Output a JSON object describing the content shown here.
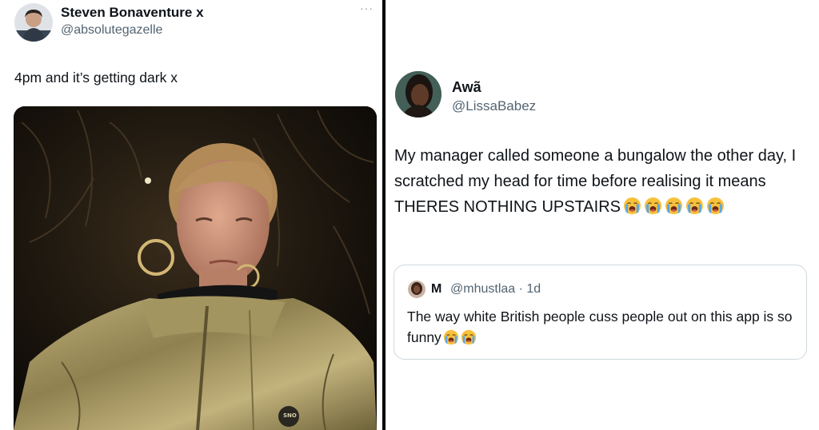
{
  "left_tweet": {
    "author_name": "Steven Bonaventure x",
    "author_handle": "@absolutegazelle",
    "more_label": "···",
    "text": "4pm and it’s getting dark x",
    "media_jacket_logo": "SNO"
  },
  "right_tweet": {
    "author_name": "Awã",
    "author_handle": "@LissaBabez",
    "text": "My manager called someone a bungalow the other day, I scratched my head for time before realising it means THERES NOTHING UPSTAIRS",
    "emoji_icon": "loudly-crying-face-icon",
    "emoji_count": 5,
    "quote": {
      "author_name": "M",
      "author_handle": "@mhustlaa · 1d",
      "text": "The way white British people cuss people out on this app is so funny",
      "emoji_icon": "loudly-crying-face-icon",
      "emoji_count": 2
    }
  },
  "colors": {
    "text_primary": "#0f1419",
    "text_secondary": "#536471",
    "border": "#cfd9de",
    "divider": "#000000",
    "emoji_face": "#f7c13c",
    "emoji_tears": "#5aa7e8"
  }
}
